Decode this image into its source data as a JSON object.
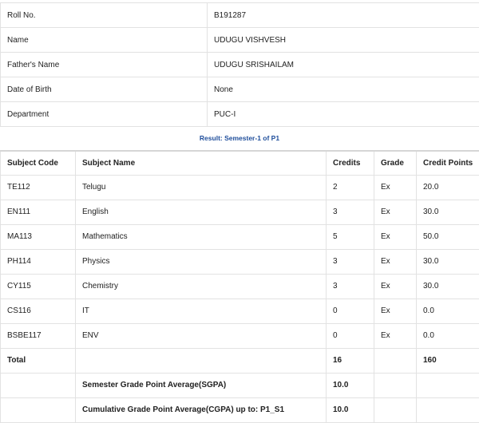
{
  "student": {
    "roll_no_label": "Roll No.",
    "roll_no": "B191287",
    "name_label": "Name",
    "name": "UDUGU VISHVESH",
    "father_label": "Father's Name",
    "father_name": "UDUGU SRISHAILAM",
    "dob_label": "Date of Birth",
    "dob": "None",
    "dept_label": "Department",
    "department": "PUC-I"
  },
  "result": {
    "caption": "Result: Semester-1 of P1",
    "caption_color": "#1f4e9b",
    "headers": {
      "code": "Subject Code",
      "name": "Subject Name",
      "credits": "Credits",
      "grade": "Grade",
      "points": "Credit Points"
    },
    "rows": [
      {
        "code": "TE112",
        "name": "Telugu",
        "credits": "2",
        "grade": "Ex",
        "points": "20.0"
      },
      {
        "code": "EN111",
        "name": "English",
        "credits": "3",
        "grade": "Ex",
        "points": "30.0"
      },
      {
        "code": "MA113",
        "name": "Mathematics",
        "credits": "5",
        "grade": "Ex",
        "points": "50.0"
      },
      {
        "code": "PH114",
        "name": "Physics",
        "credits": "3",
        "grade": "Ex",
        "points": "30.0"
      },
      {
        "code": "CY115",
        "name": "Chemistry",
        "credits": "3",
        "grade": "Ex",
        "points": "30.0"
      },
      {
        "code": "CS116",
        "name": "IT",
        "credits": "0",
        "grade": "Ex",
        "points": "0.0"
      },
      {
        "code": "BSBE117",
        "name": "ENV",
        "credits": "0",
        "grade": "Ex",
        "points": "0.0"
      }
    ],
    "total": {
      "label": "Total",
      "credits": "16",
      "points": "160"
    },
    "sgpa": {
      "label": "Semester Grade Point Average(SGPA)",
      "value": "10.0"
    },
    "cgpa": {
      "label": "Cumulative Grade Point Average(CGPA) up to: P1_S1",
      "value": "10.0"
    }
  }
}
